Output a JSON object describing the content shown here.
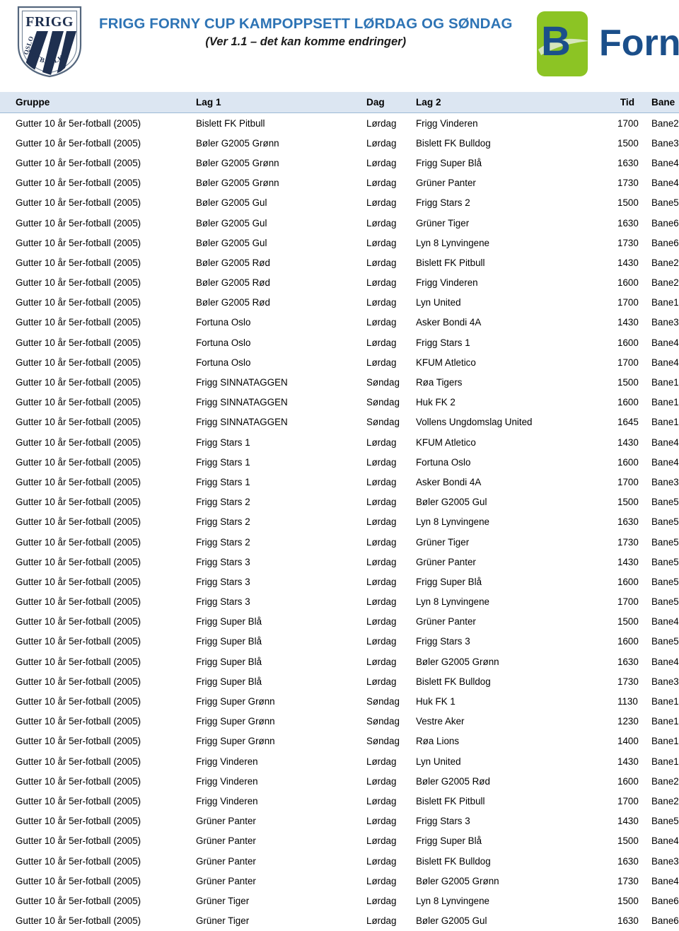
{
  "header": {
    "main_title": "FRIGG FORNY CUP KAMPOPPSETT LØRDAG OG SØNDAG",
    "sub_title": "(Ver 1.1 – det kan komme endringer)",
    "crest": {
      "name": "frigg-oslo-fotballklubb-crest",
      "top_text": "FRIGG",
      "left_text": "OSLO",
      "arc_text": "FOTBALLKLUBB",
      "color_navy": "#1f3050",
      "color_outline": "#4a5c73"
    },
    "sponsor": {
      "name": "b-forny-logo",
      "mark_letter": "B",
      "word": "Forny",
      "color_green": "#8cc424",
      "color_blue": "#1b4f8a"
    }
  },
  "colors": {
    "title_blue": "#2e74b5",
    "header_row_bg": "#dce6f2",
    "header_row_border": "#9cb9d6"
  },
  "table": {
    "columns": [
      {
        "key": "gruppe",
        "label": "Gruppe"
      },
      {
        "key": "lag1",
        "label": "Lag 1"
      },
      {
        "key": "dag",
        "label": "Dag"
      },
      {
        "key": "lag2",
        "label": "Lag 2"
      },
      {
        "key": "tid",
        "label": "Tid"
      },
      {
        "key": "bane",
        "label": "Bane"
      }
    ],
    "rows": [
      [
        "Gutter 10 år 5er-fotball (2005)",
        "Bislett FK Pitbull",
        "Lørdag",
        "Frigg Vinderen",
        "1700",
        "Bane2"
      ],
      [
        "Gutter 10 år 5er-fotball (2005)",
        "Bøler G2005 Grønn",
        "Lørdag",
        "Bislett FK Bulldog",
        "1500",
        "Bane3"
      ],
      [
        "Gutter 10 år 5er-fotball (2005)",
        "Bøler G2005 Grønn",
        "Lørdag",
        "Frigg Super Blå",
        "1630",
        "Bane4"
      ],
      [
        "Gutter 10 år 5er-fotball (2005)",
        "Bøler G2005 Grønn",
        "Lørdag",
        "Grüner Panter",
        "1730",
        "Bane4"
      ],
      [
        "Gutter 10 år 5er-fotball (2005)",
        "Bøler G2005 Gul",
        "Lørdag",
        "Frigg Stars 2",
        "1500",
        "Bane5"
      ],
      [
        "Gutter 10 år 5er-fotball (2005)",
        "Bøler G2005 Gul",
        "Lørdag",
        "Grüner Tiger",
        "1630",
        "Bane6"
      ],
      [
        "Gutter 10 år 5er-fotball (2005)",
        "Bøler G2005 Gul",
        "Lørdag",
        "Lyn 8 Lynvingene",
        "1730",
        "Bane6"
      ],
      [
        "Gutter 10 år 5er-fotball (2005)",
        "Bøler G2005 Rød",
        "Lørdag",
        "Bislett FK Pitbull",
        "1430",
        "Bane2"
      ],
      [
        "Gutter 10 år 5er-fotball (2005)",
        "Bøler G2005 Rød",
        "Lørdag",
        "Frigg Vinderen",
        "1600",
        "Bane2"
      ],
      [
        "Gutter 10 år 5er-fotball (2005)",
        "Bøler G2005 Rød",
        "Lørdag",
        "Lyn United",
        "1700",
        "Bane1"
      ],
      [
        "Gutter 10 år 5er-fotball (2005)",
        "Fortuna Oslo",
        "Lørdag",
        "Asker Bondi 4A",
        "1430",
        "Bane3"
      ],
      [
        "Gutter 10 år 5er-fotball (2005)",
        "Fortuna Oslo",
        "Lørdag",
        "Frigg Stars 1",
        "1600",
        "Bane4"
      ],
      [
        "Gutter 10 år 5er-fotball (2005)",
        "Fortuna Oslo",
        "Lørdag",
        "KFUM Atletico",
        "1700",
        "Bane4"
      ],
      [
        "Gutter 10 år 5er-fotball (2005)",
        "Frigg SINNATAGGEN",
        "Søndag",
        "Røa Tigers",
        "1500",
        "Bane1"
      ],
      [
        "Gutter 10 år 5er-fotball (2005)",
        "Frigg SINNATAGGEN",
        "Søndag",
        "Huk FK 2",
        "1600",
        "Bane1"
      ],
      [
        "Gutter 10 år 5er-fotball (2005)",
        "Frigg SINNATAGGEN",
        "Søndag",
        "Vollens Ungdomslag United",
        "1645",
        "Bane1"
      ],
      [
        "Gutter 10 år 5er-fotball (2005)",
        "Frigg Stars 1",
        "Lørdag",
        "KFUM Atletico",
        "1430",
        "Bane4"
      ],
      [
        "Gutter 10 år 5er-fotball (2005)",
        "Frigg Stars 1",
        "Lørdag",
        "Fortuna Oslo",
        "1600",
        "Bane4"
      ],
      [
        "Gutter 10 år 5er-fotball (2005)",
        "Frigg Stars 1",
        "Lørdag",
        "Asker Bondi 4A",
        "1700",
        "Bane3"
      ],
      [
        "Gutter 10 år 5er-fotball (2005)",
        "Frigg Stars 2",
        "Lørdag",
        "Bøler G2005 Gul",
        "1500",
        "Bane5"
      ],
      [
        "Gutter 10 år 5er-fotball (2005)",
        "Frigg Stars 2",
        "Lørdag",
        "Lyn 8 Lynvingene",
        "1630",
        "Bane5"
      ],
      [
        "Gutter 10 år 5er-fotball (2005)",
        "Frigg Stars 2",
        "Lørdag",
        "Grüner Tiger",
        "1730",
        "Bane5"
      ],
      [
        "Gutter 10 år 5er-fotball (2005)",
        "Frigg Stars 3",
        "Lørdag",
        "Grüner Panter",
        "1430",
        "Bane5"
      ],
      [
        "Gutter 10 år 5er-fotball (2005)",
        "Frigg Stars 3",
        "Lørdag",
        "Frigg Super Blå",
        "1600",
        "Bane5"
      ],
      [
        "Gutter 10 år 5er-fotball (2005)",
        "Frigg Stars 3",
        "Lørdag",
        "Lyn 8 Lynvingene",
        "1700",
        "Bane5"
      ],
      [
        "Gutter 10 år 5er-fotball (2005)",
        "Frigg Super Blå",
        "Lørdag",
        "Grüner Panter",
        "1500",
        "Bane4"
      ],
      [
        "Gutter 10 år 5er-fotball (2005)",
        "Frigg Super Blå",
        "Lørdag",
        "Frigg Stars 3",
        "1600",
        "Bane5"
      ],
      [
        "Gutter 10 år 5er-fotball (2005)",
        "Frigg Super Blå",
        "Lørdag",
        "Bøler G2005 Grønn",
        "1630",
        "Bane4"
      ],
      [
        "Gutter 10 år 5er-fotball (2005)",
        "Frigg Super Blå",
        "Lørdag",
        "Bislett FK Bulldog",
        "1730",
        "Bane3"
      ],
      [
        "Gutter 10 år 5er-fotball (2005)",
        "Frigg Super Grønn",
        "Søndag",
        "Huk FK 1",
        "1130",
        "Bane1"
      ],
      [
        "Gutter 10 år 5er-fotball (2005)",
        "Frigg Super Grønn",
        "Søndag",
        "Vestre Aker",
        "1230",
        "Bane1"
      ],
      [
        "Gutter 10 år 5er-fotball (2005)",
        "Frigg Super Grønn",
        "Søndag",
        "Røa Lions",
        "1400",
        "Bane1"
      ],
      [
        "Gutter 10 år 5er-fotball (2005)",
        "Frigg Vinderen",
        "Lørdag",
        "Lyn United",
        "1430",
        "Bane1"
      ],
      [
        "Gutter 10 år 5er-fotball (2005)",
        "Frigg Vinderen",
        "Lørdag",
        "Bøler G2005 Rød",
        "1600",
        "Bane2"
      ],
      [
        "Gutter 10 år 5er-fotball (2005)",
        "Frigg Vinderen",
        "Lørdag",
        "Bislett FK Pitbull",
        "1700",
        "Bane2"
      ],
      [
        "Gutter 10 år 5er-fotball (2005)",
        "Grüner Panter",
        "Lørdag",
        "Frigg Stars 3",
        "1430",
        "Bane5"
      ],
      [
        "Gutter 10 år 5er-fotball (2005)",
        "Grüner Panter",
        "Lørdag",
        "Frigg Super Blå",
        "1500",
        "Bane4"
      ],
      [
        "Gutter 10 år 5er-fotball (2005)",
        "Grüner Panter",
        "Lørdag",
        "Bislett FK Bulldog",
        "1630",
        "Bane3"
      ],
      [
        "Gutter 10 år 5er-fotball (2005)",
        "Grüner Panter",
        "Lørdag",
        "Bøler G2005 Grønn",
        "1730",
        "Bane4"
      ],
      [
        "Gutter 10 år 5er-fotball (2005)",
        "Grüner Tiger",
        "Lørdag",
        "Lyn 8 Lynvingene",
        "1500",
        "Bane6"
      ],
      [
        "Gutter 10 år 5er-fotball (2005)",
        "Grüner Tiger",
        "Lørdag",
        "Bøler G2005 Gul",
        "1630",
        "Bane6"
      ]
    ]
  }
}
